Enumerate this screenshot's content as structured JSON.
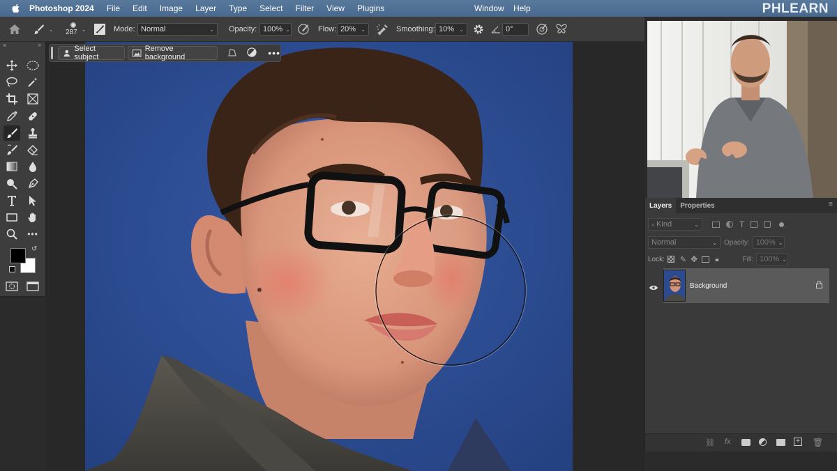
{
  "menubar": {
    "app_name": "Photoshop 2024",
    "items": [
      "File",
      "Edit",
      "Image",
      "Layer",
      "Type",
      "Select",
      "Filter",
      "View",
      "Plugins"
    ],
    "right_items": [
      "Window",
      "Help"
    ],
    "brand_logo": "PHLEARN"
  },
  "options_bar": {
    "brush_size": "287",
    "mode_label": "Mode:",
    "mode_value": "Normal",
    "opacity_label": "Opacity:",
    "opacity_value": "100%",
    "flow_label": "Flow:",
    "flow_value": "20%",
    "smoothing_label": "Smoothing:",
    "smoothing_value": "10%",
    "angle_value": "0°"
  },
  "contextual_bar": {
    "select_subject": "Select subject",
    "remove_background": "Remove background"
  },
  "layers_panel": {
    "tab_layers": "Layers",
    "tab_properties": "Properties",
    "filter_kind": "Kind",
    "blend_mode": "Normal",
    "opacity_label": "Opacity:",
    "opacity_value": "100%",
    "lock_label": "Lock:",
    "fill_label": "Fill:",
    "fill_value": "100%",
    "layers": [
      {
        "name": "Background",
        "visible": true,
        "locked": true
      }
    ]
  },
  "colors": {
    "menubar": "#4c6e93",
    "panel": "#3d3d3d",
    "photo_bg": "#2c4a8e",
    "foreground_swatch": "#000000",
    "background_swatch": "#ffffff"
  }
}
